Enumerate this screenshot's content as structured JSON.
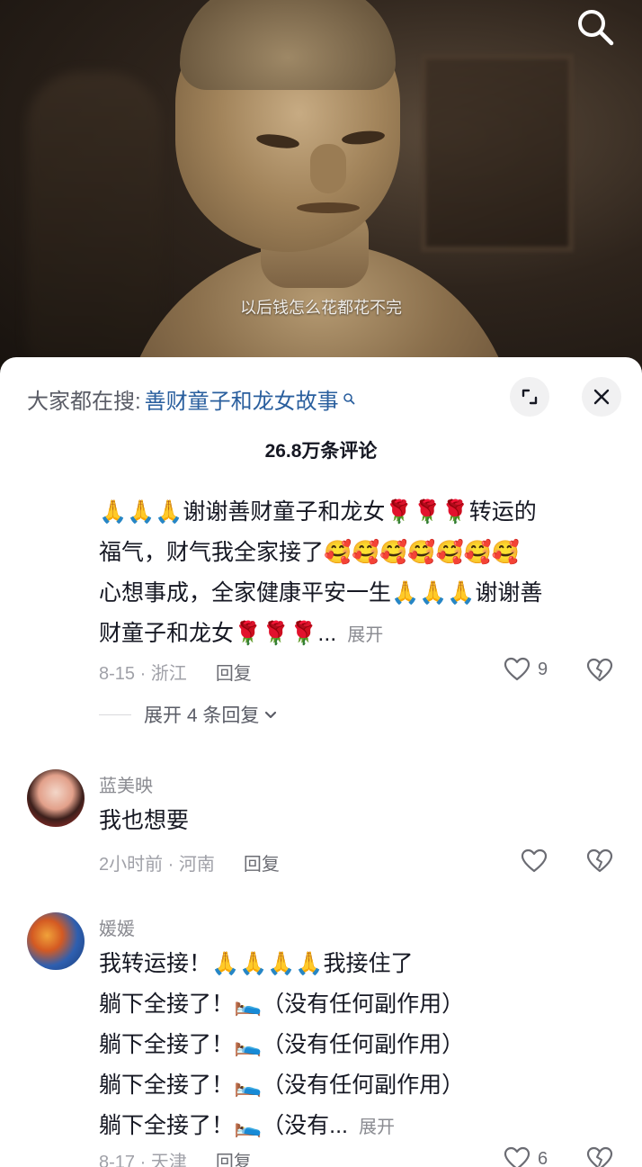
{
  "video": {
    "subtitle": "以后钱怎么花都花不完",
    "search_icon": "search-icon"
  },
  "sheet": {
    "search_prefix": "大家都在搜:",
    "search_term": "善财童子和龙女故事",
    "comment_count": "26.8万条评论",
    "expand_icon": "expand-icon",
    "close_icon": "close-icon"
  },
  "comments": [
    {
      "lines": [
        "🙏🙏🙏谢谢善财童子和龙女🌹🌹🌹转运的",
        "福气，财气我全家接了🥰🥰🥰🥰🥰🥰🥰",
        "心想事成，全家健康平安一生🙏🙏🙏谢谢善",
        "财童子和龙女🌹🌹🌹..."
      ],
      "expand": "展开",
      "date_location": "8-15 · 浙江",
      "reply": "回复",
      "likes": "9",
      "expand_replies": "展开 4 条回复"
    },
    {
      "username": "蓝美映",
      "text": "我也想要",
      "date_location": "2小时前 · 河南",
      "reply": "回复"
    },
    {
      "username": "媛媛",
      "lines": [
        "我转运接！🙏🙏🙏🙏我接住了",
        "躺下全接了！🛌（没有任何副作用）",
        "躺下全接了！🛌（没有任何副作用）",
        "躺下全接了！🛌（没有任何副作用）",
        "躺下全接了！🛌（没有..."
      ],
      "expand": "展开",
      "date_location": "8-17 · 天津",
      "reply": "回复",
      "likes": "6"
    }
  ],
  "colors": {
    "search_term": "#2a5f9e",
    "meta_gray": "#a0a1a8",
    "text": "#161823"
  }
}
